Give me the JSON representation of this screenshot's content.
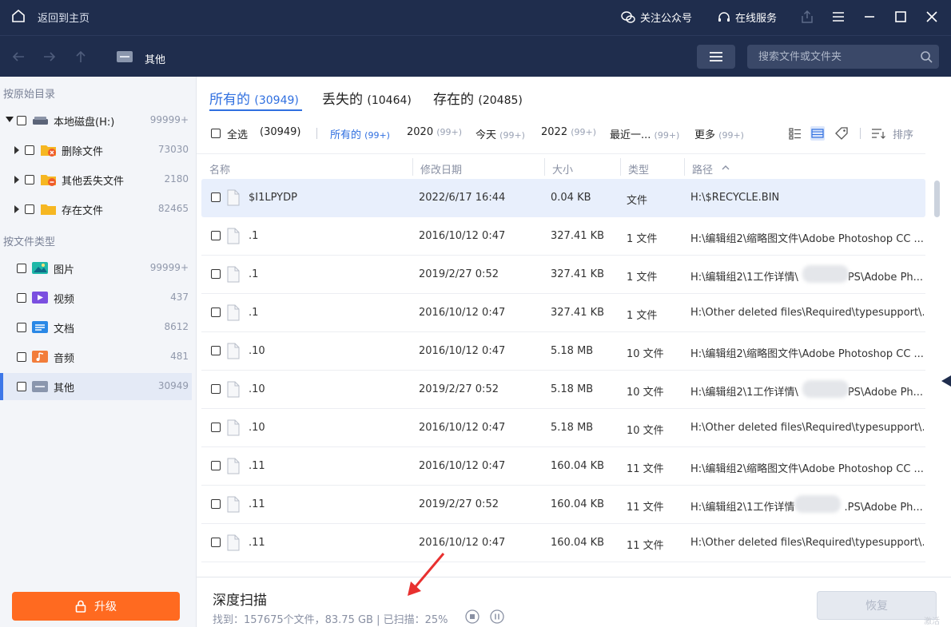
{
  "titlebar": {
    "home_label": "返回到主页",
    "follow_label": "关注公众号",
    "service_label": "在线服务"
  },
  "navbar": {
    "breadcrumb": "其他",
    "search_placeholder": "搜索文件或文件夹"
  },
  "sidebar": {
    "section_original": "按原始目录",
    "section_type": "按文件类型",
    "tree": [
      {
        "label": "本地磁盘(H:)",
        "count": "99999+",
        "icon": "drive-icon"
      },
      {
        "label": "删除文件",
        "count": "73030",
        "icon": "deleted-folder-icon"
      },
      {
        "label": "其他丢失文件",
        "count": "2180",
        "icon": "lost-folder-icon"
      },
      {
        "label": "存在文件",
        "count": "82465",
        "icon": "folder-icon"
      }
    ],
    "types": [
      {
        "label": "图片",
        "count": "99999+",
        "icon": "image-icon"
      },
      {
        "label": "视频",
        "count": "437",
        "icon": "video-icon"
      },
      {
        "label": "文档",
        "count": "8612",
        "icon": "document-icon"
      },
      {
        "label": "音频",
        "count": "481",
        "icon": "audio-icon"
      },
      {
        "label": "其他",
        "count": "30949",
        "icon": "other-icon"
      }
    ],
    "upgrade_label": "升级"
  },
  "tabs": [
    {
      "label": "所有的",
      "count": "(30949)"
    },
    {
      "label": "丢失的",
      "count": "(10464)"
    },
    {
      "label": "存在的",
      "count": "(20485)"
    }
  ],
  "filters": {
    "select_all": "全选",
    "select_all_count": "(30949)",
    "items": [
      {
        "label": "所有的",
        "n": "(99+)"
      },
      {
        "label": "2020",
        "n": "(99+)"
      },
      {
        "label": "今天",
        "n": "(99+)"
      },
      {
        "label": "2022",
        "n": "(99+)"
      },
      {
        "label": "最近一...",
        "n": "(99+)"
      },
      {
        "label": "更多",
        "n": "(99+)"
      }
    ],
    "sort_label": "排序"
  },
  "table": {
    "headers": [
      "名称",
      "修改日期",
      "大小",
      "类型",
      "路径"
    ],
    "rows": [
      {
        "name": "$I1LPYDP",
        "date": "2022/6/17 16:44",
        "size": "0.04 KB",
        "type": "文件",
        "path": "H:\\$RECYCLE.BIN"
      },
      {
        "name": ".1",
        "date": "2016/10/12 0:47",
        "size": "327.41 KB",
        "type": "1 文件",
        "path": "H:\\编辑组2\\缩略图文件\\Adobe Photoshop CC ..."
      },
      {
        "name": ".1",
        "date": "2019/2/27 0:52",
        "size": "327.41 KB",
        "type": "1 文件",
        "path": "H:\\编辑组2\\1工作详情\\",
        "path2": "PS\\Adobe Ph..."
      },
      {
        "name": ".1",
        "date": "2016/10/12 0:47",
        "size": "327.41 KB",
        "type": "1 文件",
        "path": "H:\\Other deleted files\\Required\\typesupport\\.f"
      },
      {
        "name": ".10",
        "date": "2016/10/12 0:47",
        "size": "5.18 MB",
        "type": "10 文件",
        "path": "H:\\编辑组2\\缩略图文件\\Adobe Photoshop CC ..."
      },
      {
        "name": ".10",
        "date": "2019/2/27 0:52",
        "size": "5.18 MB",
        "type": "10 文件",
        "path": "H:\\编辑组2\\1工作详情\\",
        "path2": "PS\\Adobe Ph..."
      },
      {
        "name": ".10",
        "date": "2016/10/12 0:47",
        "size": "5.18 MB",
        "type": "10 文件",
        "path": "H:\\Other deleted files\\Required\\typesupport\\.f"
      },
      {
        "name": ".11",
        "date": "2016/10/12 0:47",
        "size": "160.04 KB",
        "type": "11 文件",
        "path": "H:\\编辑组2\\缩略图文件\\Adobe Photoshop CC ..."
      },
      {
        "name": ".11",
        "date": "2019/2/27 0:52",
        "size": "160.04 KB",
        "type": "11 文件",
        "path": "H:\\编辑组2\\1工作详情",
        "path2": ".PS\\Adobe Ph..."
      },
      {
        "name": ".11",
        "date": "2016/10/12 0:47",
        "size": "160.04 KB",
        "type": "11 文件",
        "path": "H:\\Other deleted files\\Required\\typesupport\\.f"
      }
    ]
  },
  "bottom": {
    "title": "深度扫描",
    "status": "找到：157675个文件，83.75 GB | 已扫描：25%",
    "recover_label": "恢复"
  },
  "watermark": "激活"
}
